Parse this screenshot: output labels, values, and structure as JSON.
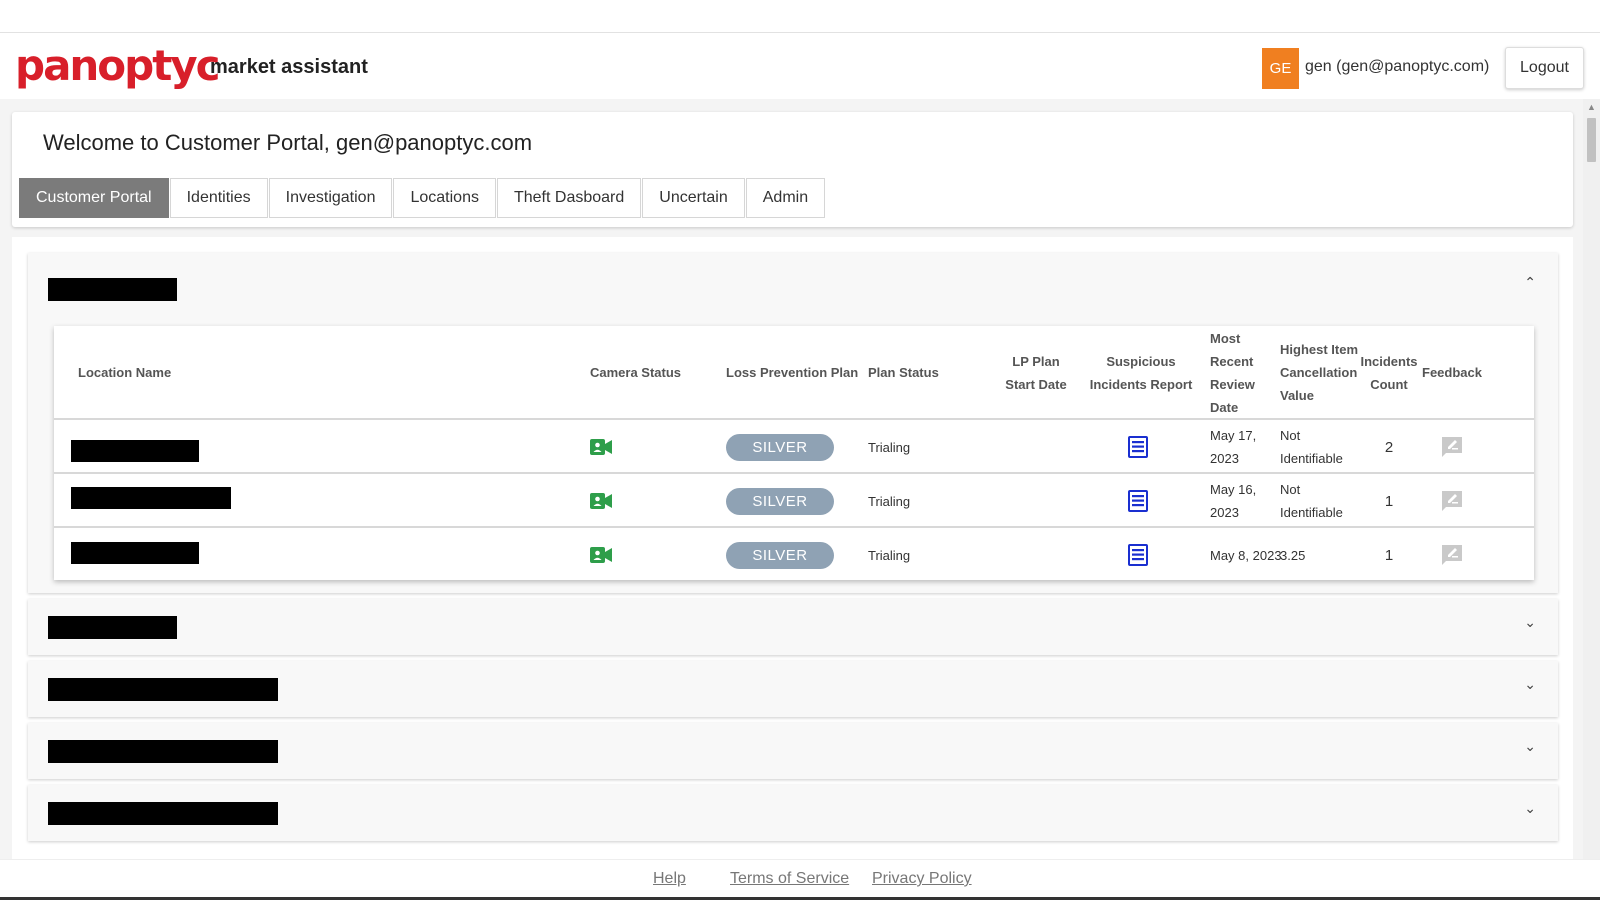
{
  "header": {
    "logo_text": "panoptyc",
    "logo_subtitle": "market assistant",
    "user_initials": "GE",
    "user_label": "gen (gen@panoptyc.com)",
    "logout_label": "Logout"
  },
  "welcome": {
    "title": "Welcome to Customer Portal, gen@panoptyc.com"
  },
  "tabs": [
    {
      "label": "Customer Portal",
      "active": true
    },
    {
      "label": "Identities"
    },
    {
      "label": "Investigation"
    },
    {
      "label": "Locations"
    },
    {
      "label": "Theft Dasboard"
    },
    {
      "label": "Uncertain"
    },
    {
      "label": "Admin"
    }
  ],
  "table": {
    "headers": {
      "location_name": "Location Name",
      "camera_status": "Camera Status",
      "loss_prevention_plan": "Loss Prevention Plan",
      "plan_status": "Plan Status",
      "lp_plan_start_date": "LP Plan Start Date",
      "suspicious_incidents_report": "Suspicious Incidents Report",
      "most_recent_review_date": "Most Recent Review Date",
      "highest_item_cancellation_value": "Highest Item Cancellation Value",
      "incidents_count": "Incidents Count",
      "feedback": "Feedback"
    },
    "rows": [
      {
        "plan": "SILVER",
        "plan_status": "Trialing",
        "review_date": "May 17, 2023",
        "highest_value": "Not Identifiable",
        "incidents": "2"
      },
      {
        "plan": "SILVER",
        "plan_status": "Trialing",
        "review_date": "May 16, 2023",
        "highest_value": "Not Identifiable",
        "incidents": "1"
      },
      {
        "plan": "SILVER",
        "plan_status": "Trialing",
        "review_date": "May 8, 2023",
        "highest_value": "3.25",
        "incidents": "1"
      }
    ]
  },
  "icons": {
    "camera": "video-camera-icon",
    "report": "document-icon",
    "feedback": "feedback-icon",
    "expand": "chevron-down-icon",
    "collapse": "chevron-up-icon"
  },
  "colors": {
    "brand": "#d81f2a",
    "avatar": "#f07f20",
    "active_tab": "#7b7b7b",
    "plan_pill": "#8fa2b4",
    "camera_ok": "#2e9e4a",
    "report_icon": "#1a2fd0"
  },
  "footer": {
    "help": "Help",
    "terms": "Terms of Service",
    "privacy": "Privacy Policy"
  }
}
